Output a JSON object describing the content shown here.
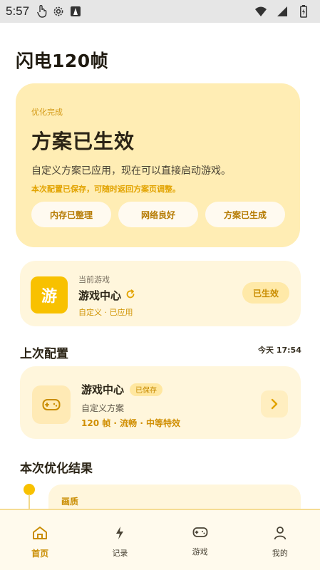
{
  "status_bar": {
    "time": "5:57"
  },
  "app": {
    "title": "闪电120帧"
  },
  "hero": {
    "tag": "优化完成",
    "title": "方案已生效",
    "description": "自定义方案已应用，现在可以直接启动游戏。",
    "note": "本次配置已保存，可随时返回方案页调整。",
    "chips": [
      "内存已整理",
      "网络良好",
      "方案已生成"
    ]
  },
  "current_game": {
    "label": "当前游戏",
    "icon_char": "游",
    "name": "游戏中心",
    "sub": "自定义 · 已应用",
    "status": "已生效"
  },
  "last_config": {
    "section_title": "上次配置",
    "time": "今天 17:54",
    "name": "游戏中心",
    "badge": "已保存",
    "description": "自定义方案",
    "detail": "120 帧 · 流畅 · 中等特效"
  },
  "result": {
    "section_title": "本次优化结果",
    "first_item_label": "画质"
  },
  "bottom_nav": {
    "items": [
      {
        "label": "首页",
        "icon": "home-icon",
        "active": true
      },
      {
        "label": "记录",
        "icon": "lightning-icon",
        "active": false
      },
      {
        "label": "游戏",
        "icon": "gamepad-icon",
        "active": false
      },
      {
        "label": "我的",
        "icon": "user-icon",
        "active": false
      }
    ]
  },
  "colors": {
    "accent": "#f8c100",
    "accent_text": "#c98c00",
    "hero_bg": "#ffedb4",
    "card_bg": "#fff6dc"
  }
}
